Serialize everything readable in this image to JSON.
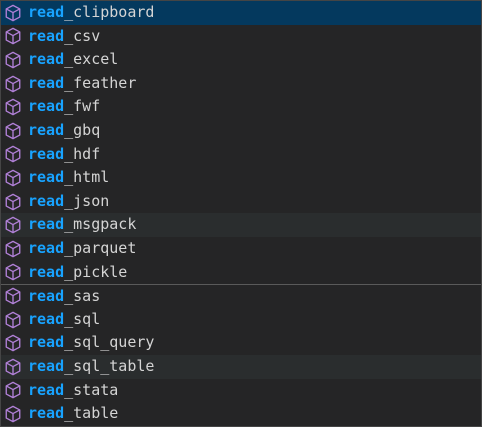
{
  "suggestions": {
    "match_prefix": "read",
    "icon": "method-cube-icon",
    "icon_color": "#b180d7",
    "match_color": "#18a3ff",
    "items": [
      {
        "suffix": "_clipboard",
        "state": "selected"
      },
      {
        "suffix": "_csv",
        "state": ""
      },
      {
        "suffix": "_excel",
        "state": ""
      },
      {
        "suffix": "_feather",
        "state": ""
      },
      {
        "suffix": "_fwf",
        "state": ""
      },
      {
        "suffix": "_gbq",
        "state": ""
      },
      {
        "suffix": "_hdf",
        "state": ""
      },
      {
        "suffix": "_html",
        "state": ""
      },
      {
        "suffix": "_json",
        "state": ""
      },
      {
        "suffix": "_msgpack",
        "state": "hover"
      },
      {
        "suffix": "_parquet",
        "state": ""
      },
      {
        "suffix": "_pickle",
        "state": ""
      },
      {
        "suffix": "_sas",
        "state": "divider"
      },
      {
        "suffix": "_sql",
        "state": ""
      },
      {
        "suffix": "_sql_query",
        "state": ""
      },
      {
        "suffix": "_sql_table",
        "state": "hover"
      },
      {
        "suffix": "_stata",
        "state": ""
      },
      {
        "suffix": "_table",
        "state": ""
      }
    ]
  }
}
